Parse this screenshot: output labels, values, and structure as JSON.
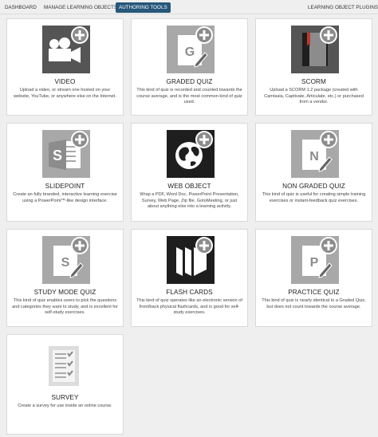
{
  "nav": {
    "dashboard": "DASHBOARD",
    "manage": "MANAGE LEARNING OBJECTS",
    "authoring": "AUTHORING TOOLS",
    "plugins": "LEARNING OBJECT PLUGINS"
  },
  "cards": [
    {
      "title": "VIDEO",
      "desc": "Upload a video, or stream one hosted on your website, YouTube, or anywhere else on the Internet.",
      "icon": "video-camera-icon"
    },
    {
      "title": "GRADED QUIZ",
      "desc": "This kind of quiz is recorded and counted towards the course average, and is the most common kind of quiz used.",
      "icon": "graded-quiz-icon",
      "icon_letter": "G"
    },
    {
      "title": "SCORM",
      "desc": "Upload a SCORM 1.2 package (created with Camtasia, Captivate, Articulate, etc.) or purchased from a vendor.",
      "icon": "scorm-book-icon"
    },
    {
      "title": "SLIDEPOINT",
      "desc": "Create an fully branded, interactive learning exercise using a PowerPoint™-like design interface.",
      "icon": "slidepoint-icon",
      "icon_letter": "S"
    },
    {
      "title": "WEB OBJECT",
      "desc": "Wrap a PDF, Word Doc, PowerPoint Presentation, Survey, Web Page, Zip file, GotoMeeting, or just about anything else into a learning activity.",
      "icon": "globe-icon"
    },
    {
      "title": "NON GRADED QUIZ",
      "desc": "This kind of quiz is useful for creating simple training exercises or instant-feedback quiz exercises.",
      "icon": "non-graded-quiz-icon",
      "icon_letter": "N"
    },
    {
      "title": "STUDY MODE QUIZ",
      "desc": "This kind of quiz enables users to pick the questions and categories they want to study, and is excellent for self-study exercises.",
      "icon": "study-mode-quiz-icon",
      "icon_letter": "S"
    },
    {
      "title": "FLASH CARDS",
      "desc": "This kind of quiz operates like an electronic version of front/back physical flashcards, and is good for self-study exercises.",
      "icon": "flash-cards-icon"
    },
    {
      "title": "PRACTICE QUIZ",
      "desc": "This kind of quiz is nearly identical to a Graded Quiz, but does not count towards the course average.",
      "icon": "practice-quiz-icon",
      "icon_letter": "P"
    },
    {
      "title": "SURVEY",
      "desc": "Create a survey for use inside an online course.",
      "icon": "survey-checklist-icon"
    }
  ],
  "colors": {
    "nav_active_bg": "#27577b",
    "icon_dark": "#555555",
    "icon_mid": "#8c8c8c",
    "icon_light": "#a8a8a8",
    "icon_black": "#1e1e1e"
  }
}
